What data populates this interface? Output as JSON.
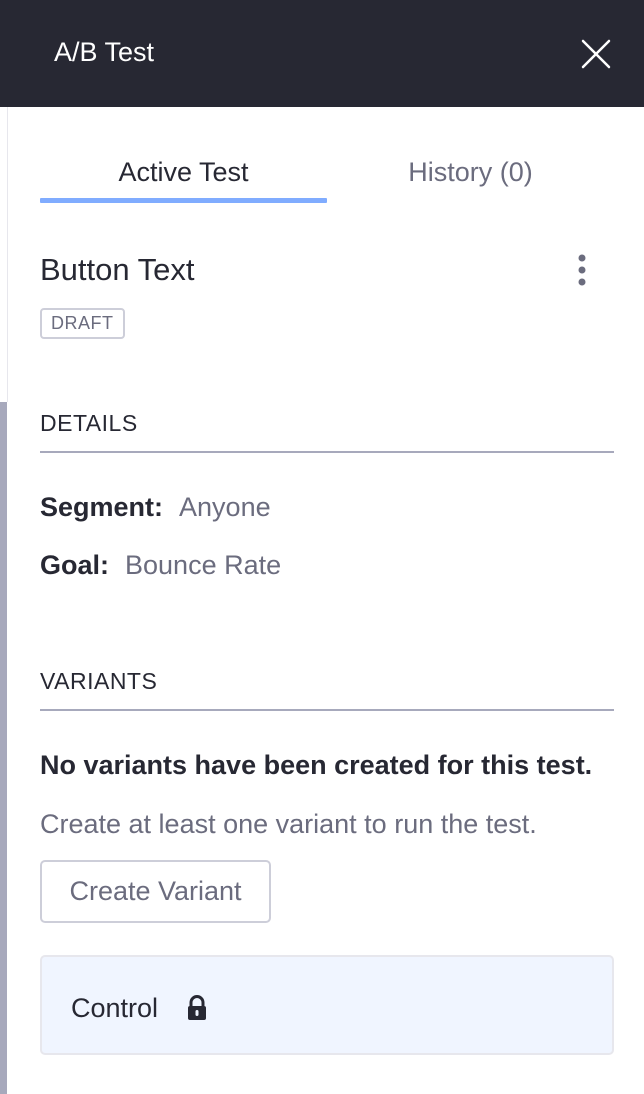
{
  "header": {
    "title": "A/B Test",
    "close_icon": "close-icon"
  },
  "tabs": [
    {
      "label": "Active Test",
      "active": true
    },
    {
      "label": "History (0)",
      "active": false
    }
  ],
  "test": {
    "title": "Button Text",
    "status_badge": "DRAFT",
    "menu_icon": "vertical-ellipsis-icon"
  },
  "details": {
    "section_title": "DETAILS",
    "segment_label": "Segment:",
    "segment_value": "Anyone",
    "goal_label": "Goal:",
    "goal_value": "Bounce Rate"
  },
  "variants": {
    "section_title": "VARIANTS",
    "empty_title": "No variants have been created for this test.",
    "empty_description": "Create at least one variant to run the test.",
    "create_button": "Create Variant",
    "control_label": "Control",
    "control_icon": "lock-icon"
  },
  "colors": {
    "header_bg": "#272833",
    "tab_accent": "#80acff",
    "control_bg": "#f0f5ff",
    "muted_text": "#6b6c7e"
  }
}
